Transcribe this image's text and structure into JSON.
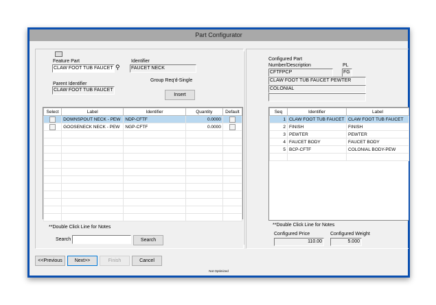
{
  "window": {
    "title": "Part Configurator",
    "status": "Not Optimized"
  },
  "left": {
    "feature_part_label": "Feature Part",
    "feature_part_value": "CLAW FOOT TUB FAUCET",
    "identifier_label": "Identifier",
    "identifier_value": "FAUCET NECK",
    "parent_identifier_label": "Parent Identifier",
    "parent_identifier_value": "CLAW FOOT TUB FAUCET",
    "group_text": "Group Req'd-Single",
    "insert_label": "Insert",
    "columns": [
      "Select",
      "Label",
      "Identifier",
      "Quantity",
      "Default"
    ],
    "rows": [
      {
        "label": "DOWNSPOUT NECK - PEW",
        "identifier": "NDP-CFTF",
        "quantity": "0.0000"
      },
      {
        "label": "GOOSENECK NECK - PEW",
        "identifier": "NGP-CFTF",
        "quantity": "0.0000"
      }
    ],
    "notes": "**Double Click Line for Notes",
    "search_label": "Search",
    "search_value": "",
    "search_button": "Search"
  },
  "right": {
    "configured_part_label": "Configured Part",
    "number_desc_label": "Number/Description",
    "pl_label": "PL",
    "part_number": "CFTFPCP",
    "pl_value": "FG",
    "description": "CLAW FOOT TUB FAUCET PEWTER",
    "desc2": "COLONIAL",
    "desc3": "",
    "columns": [
      "Seq",
      "Identifier",
      "Label"
    ],
    "rows": [
      {
        "seq": "1",
        "identifier": "CLAW FOOT TUB FAUCET",
        "label": "CLAW FOOT TUB FAUCET"
      },
      {
        "seq": "2",
        "identifier": "FINISH",
        "label": "FINISH"
      },
      {
        "seq": "3",
        "identifier": "PEWTER",
        "label": "PEWTER"
      },
      {
        "seq": "4",
        "identifier": "FAUCET BODY",
        "label": "FAUCET BODY"
      },
      {
        "seq": "5",
        "identifier": "BCP-CFTF",
        "label": "COLONIAL BODY-PEW"
      }
    ],
    "notes": "**Double Click Line for Notes",
    "price_label": "Configured Price",
    "price_value": "110.00",
    "weight_label": "Configured Weight",
    "weight_value": "5.000"
  },
  "buttons": {
    "previous": "<<Previous",
    "next": "Next>>",
    "finish": "Finish",
    "cancel": "Cancel"
  }
}
